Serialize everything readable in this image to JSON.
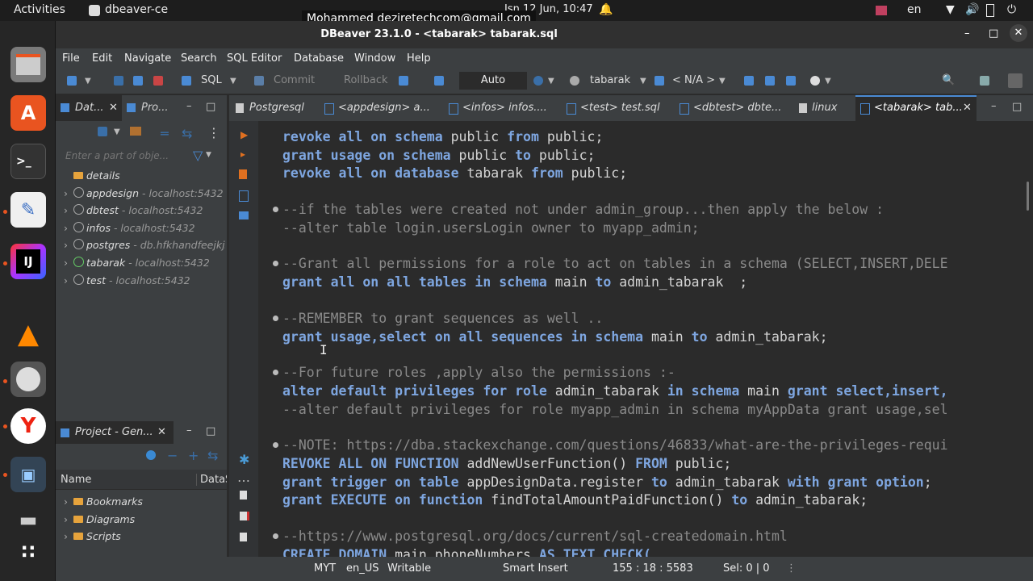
{
  "topbar": {
    "activities": "Activities",
    "app_name": "dbeaver-ce",
    "user_email": "Mohammed deziretechcom@gmail.com",
    "datetime": "Isn 12 Jun, 10:47",
    "lang": "en"
  },
  "window": {
    "title": "DBeaver 23.1.0 - <tabarak> tabarak.sql"
  },
  "menu": [
    "File",
    "Edit",
    "Navigate",
    "Search",
    "SQL Editor",
    "Database",
    "Window",
    "Help"
  ],
  "toolbar": {
    "sql_label": "SQL",
    "commit_label": "Commit",
    "rollback_label": "Rollback",
    "txn_mode": "Auto",
    "datasource": "tabarak",
    "schema": "< N/A >"
  },
  "left_tabs": {
    "navigator": "Dat...",
    "projects": "Pro..."
  },
  "navigator": {
    "filter_placeholder": "Enter a part of obje...",
    "items": [
      {
        "name": "details",
        "host": ""
      },
      {
        "name": "appdesign",
        "host": " - localhost:5432"
      },
      {
        "name": "dbtest",
        "host": " - localhost:5432"
      },
      {
        "name": "infos",
        "host": " - localhost:5432"
      },
      {
        "name": "postgres",
        "host": " - db.hfkhandfeejkjs"
      },
      {
        "name": "tabarak",
        "host": " - localhost:5432"
      },
      {
        "name": "test",
        "host": " - localhost:5432"
      }
    ]
  },
  "project_panel": {
    "title": "Project - Gen...",
    "col_name": "Name",
    "col_datasource": "DataS",
    "items": [
      "Bookmarks",
      "Diagrams",
      "Scripts"
    ]
  },
  "editor_tabs": [
    "Postgresql",
    "<appdesign> a...",
    "<infos> infos....",
    "<test> test.sql",
    "<dbtest> dbte...",
    "linux",
    "<tabarak> tab..."
  ],
  "editor_lines": {
    "l1a": "revoke all on schema",
    "l1b": " public ",
    "l1c": "from",
    "l1d": " public;",
    "l2a": "grant usage on schema",
    "l2b": " public ",
    "l2c": "to",
    "l2d": " public;",
    "l3a": "revoke all on database",
    "l3b": " tabarak ",
    "l3c": "from",
    "l3d": " public;",
    "c1": "--if the tables were created not under admin_group...then apply the below :",
    "c2": "--alter table login.usersLogin owner to myapp_admin;",
    "c3": "--Grant all permissions for a role to act on tables in a schema (SELECT,INSERT,DELE",
    "l4a": "grant all on all tables in schema",
    "l4b": " main ",
    "l4c": "to",
    "l4d": " admin_tabarak  ;",
    "c4": "--REMEMBER to grant sequences as well ..",
    "l5a": "grant usage,select on all sequences in schema",
    "l5b": " main ",
    "l5c": "to",
    "l5d": " admin_tabarak;",
    "c5": "--For future roles ,apply also the permissions :-",
    "l6a": "alter default privileges for role",
    "l6b": " admin_tabarak ",
    "l6c": "in schema",
    "l6d": " main ",
    "l6e": "grant select,insert,",
    "c6": "--alter default privileges for role myapp_admin in schema myAppData grant usage,sel",
    "c7": "--NOTE: https://dba.stackexchange.com/questions/46833/what-are-the-privileges-requi",
    "l7a": "REVOKE ALL ON FUNCTION",
    "l7b": " addNewUserFunction() ",
    "l7c": "FROM",
    "l7d": " public;",
    "l8a": "grant trigger on table",
    "l8b": " appDesignData.register ",
    "l8c": "to",
    "l8d": " admin_tabarak ",
    "l8e": "with grant option",
    "l8f": ";",
    "l9a": "grant EXECUTE on function",
    "l9b": " findTotalAmountPaidFunction() ",
    "l9c": "to",
    "l9d": " admin_tabarak;",
    "c8": "--https://www.postgresql.org/docs/current/sql-createdomain.html",
    "l10a": "CREATE DOMAIN",
    "l10b": " main.phoneNumbers ",
    "l10c": "AS TEXT CHECK("
  },
  "status": {
    "timezone": "MYT",
    "locale": "en_US",
    "mode": "Writable",
    "insert_mode": "Smart Insert",
    "position": "155 : 18 : 5583",
    "selection": "Sel: 0 | 0"
  },
  "colors": {
    "keyword": "#7ea6e0",
    "comment": "#8a8a8a",
    "accent": "#e95420"
  }
}
